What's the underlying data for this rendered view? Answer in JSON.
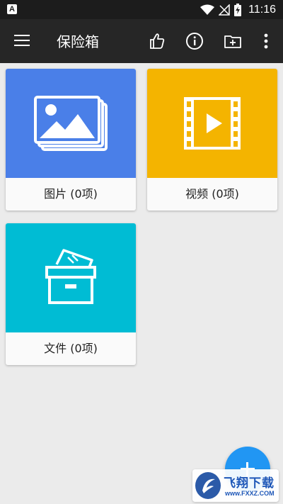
{
  "status_bar": {
    "time": "11:16",
    "left_icon_text": "A",
    "icons": [
      "app-notification-icon",
      "wifi-icon",
      "no-signal-icon",
      "battery-charging-icon"
    ]
  },
  "app_bar": {
    "title": "保险箱",
    "icons": [
      "menu-icon",
      "thumbs-up-icon",
      "info-icon",
      "add-folder-icon",
      "more-vert-icon"
    ]
  },
  "cards": {
    "photos": {
      "label": "图片 (0项)",
      "color": "#4a7fe8",
      "icon": "image-stack-icon"
    },
    "videos": {
      "label": "视频 (0项)",
      "color": "#f4b400",
      "icon": "video-film-icon"
    },
    "files": {
      "label": "文件 (0项)",
      "color": "#00bcd4",
      "icon": "archive-box-icon"
    }
  },
  "fab": {
    "icon": "plus-icon",
    "color": "#2196f3"
  },
  "watermark": {
    "text": "飞翔下载",
    "url": "www.FXXZ.COM"
  },
  "colors": {
    "status_bar": "#1c1c1c",
    "app_bar": "#262626",
    "background": "#ebebeb"
  }
}
